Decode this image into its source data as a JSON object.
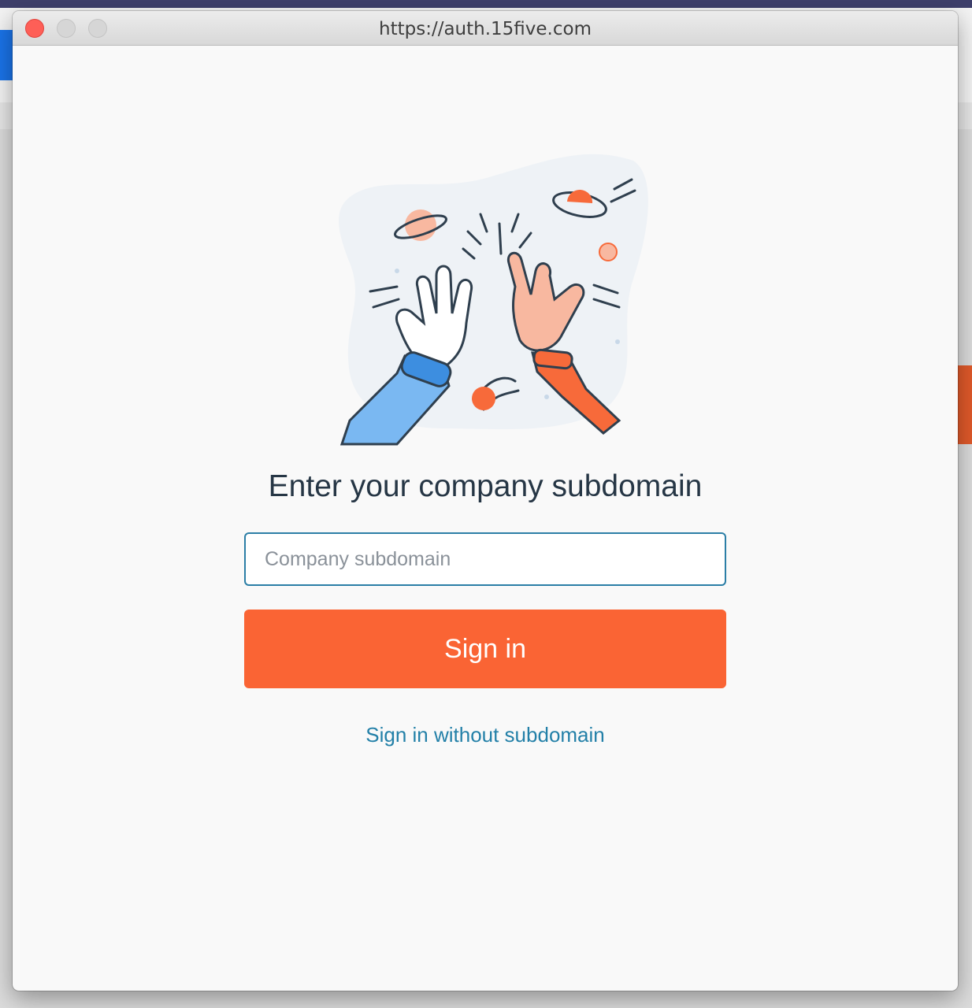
{
  "window": {
    "title": "https://auth.15five.com"
  },
  "illustration": {
    "name": "high-five-illustration"
  },
  "form": {
    "heading": "Enter your company subdomain",
    "subdomain_value": "",
    "subdomain_placeholder": "Company subdomain",
    "submit_label": "Sign in",
    "alt_link_label": "Sign in without subdomain"
  },
  "colors": {
    "accent": "#fa6434",
    "link": "#2380a8",
    "heading": "#263645",
    "input_border": "#2b7ea6",
    "close_button": "#fe5f57"
  }
}
